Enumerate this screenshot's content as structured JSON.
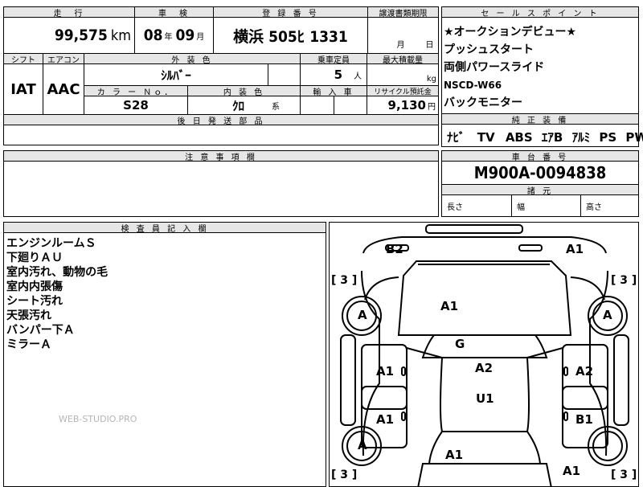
{
  "vehicle": {
    "mileage_header": "走　行",
    "mileage_value": "99,575",
    "mileage_unit": "km",
    "inspection_header": "車　検",
    "inspection_year": "08",
    "inspection_year_unit": "年",
    "inspection_month": "09",
    "inspection_month_unit": "月",
    "registration_header": "登 録 番 号",
    "registration_value": "横浜 505ﾋ 1331",
    "transfer_header": "譲渡書類期限",
    "transfer_month_unit": "月",
    "transfer_day_unit": "日",
    "shift_header": "シフト",
    "shift_value": "IAT",
    "ac_header": "エアコン",
    "ac_value": "AAC",
    "exterior_color_header": "外 装 色",
    "exterior_color_value": "ｼﾙﾊﾞｰ",
    "capacity_header": "乗車定員",
    "capacity_value": "5",
    "capacity_unit": "人",
    "max_load_header": "最大積載量",
    "max_load_unit": "kg",
    "color_no_header": "カ ラ ー Ｎｏ．",
    "color_no_value": "S28",
    "interior_color_header": "内 装 色",
    "interior_color_value": "ｸﾛ",
    "interior_color_unit": "系",
    "import_header": "輸 入 車",
    "recycle_header": "リサイクル預託金",
    "recycle_value": "9,130",
    "recycle_unit": "円",
    "parts_header": "後 日 発 送 部 品"
  },
  "sales_points": {
    "header": "セ ー ル ス ポ イ ン ト",
    "lines": [
      "★オークションデビュー★",
      "プッシュスタート",
      "両側パワースライド",
      "NSCD-W66",
      "バックモニター"
    ]
  },
  "equipment": {
    "header": "純 正 装 備",
    "items": [
      "ﾅﾋﾞ",
      "TV",
      "ABS",
      "ｴｱB",
      "ｱﾙﾐ",
      "PS",
      "PW"
    ]
  },
  "notes": {
    "header": "注 意 事 項 欄"
  },
  "chassis": {
    "header": "車 台 番 号",
    "value": "M900A-0094838",
    "dimensions_header": "諸 元",
    "length_label": "長さ",
    "width_label": "幅",
    "height_label": "高さ"
  },
  "inspector": {
    "header": "検 査 員 記 入 欄",
    "lines": [
      "エンジンルームＳ",
      "下廻りＡＵ",
      "室内汚れ、動物の毛",
      "室内内張傷",
      "シート汚れ",
      "天張汚れ",
      "バンパー下Ａ",
      "ミラーＡ"
    ],
    "watermark": "WEB-STUDIO.PRO"
  },
  "diagram": {
    "marks": {
      "front_left": "B2",
      "front_right": "A1",
      "hood": "A1",
      "windshield": "G",
      "left_front_door": "A1",
      "right_front_door": "A2",
      "roof": "A2",
      "roof_rear": "U1",
      "left_rear_door": "A1",
      "right_rear_door": "B1",
      "rear_panel": "A1",
      "rear_right": "A1",
      "wheel_fl": "A",
      "wheel_fr": "A",
      "wheel_rl": "A",
      "tread": "3"
    },
    "bracket_open": "[",
    "bracket_close": "]"
  }
}
